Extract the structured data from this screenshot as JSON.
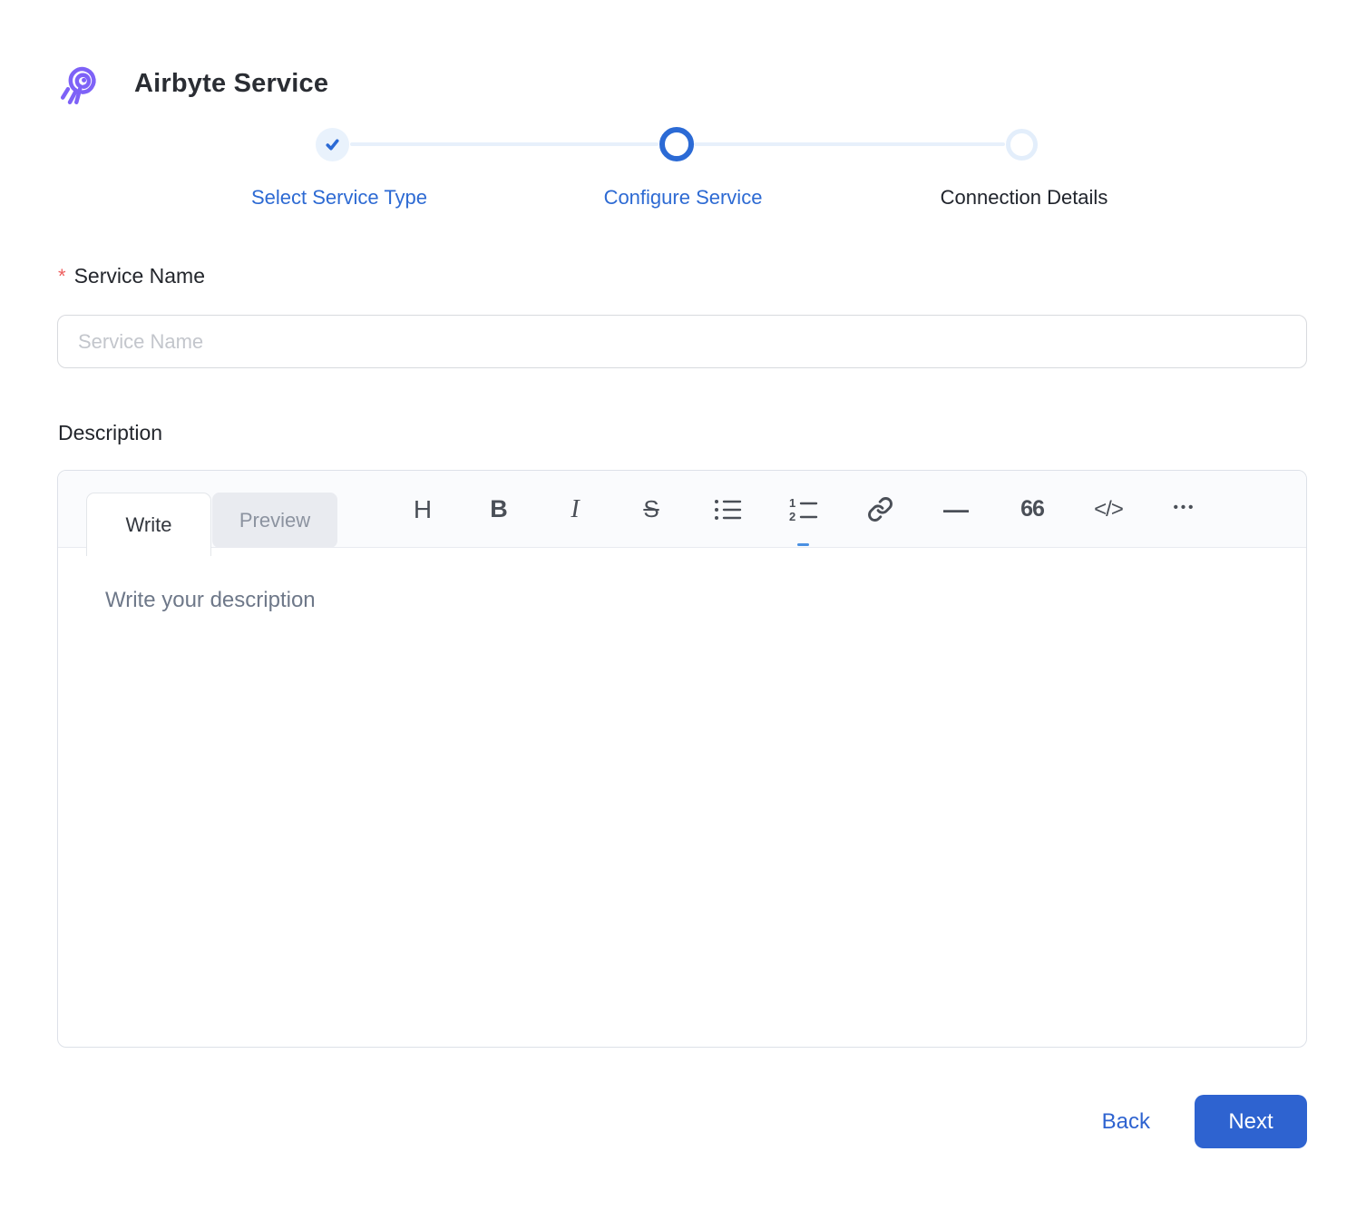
{
  "header": {
    "title": "Airbyte Service"
  },
  "stepper": {
    "steps": [
      {
        "label": "Select Service Type",
        "state": "completed",
        "icon": "check-icon"
      },
      {
        "label": "Configure Service",
        "state": "active",
        "icon": "ring-icon"
      },
      {
        "label": "Connection Details",
        "state": "upcoming",
        "icon": "ring-icon"
      }
    ]
  },
  "form": {
    "service_name": {
      "required_marker": "*",
      "label": "Service Name",
      "placeholder": "Service Name",
      "value": ""
    },
    "description": {
      "label": "Description",
      "tabs": [
        {
          "label": "Write"
        },
        {
          "label": "Preview"
        }
      ],
      "active_tab": "Write",
      "toolbar": {
        "heading": "H",
        "bold": "B",
        "italic": "I",
        "strikethrough": "S",
        "hr": "—",
        "quote": "66",
        "code": "</>",
        "more": "•••",
        "icons": [
          "heading-icon",
          "bold-icon",
          "italic-icon",
          "strikethrough-icon",
          "unordered-list-icon",
          "ordered-list-icon",
          "link-icon",
          "horizontal-rule-icon",
          "quote-icon",
          "code-icon",
          "more-icon"
        ]
      },
      "placeholder": "Write your description",
      "value": ""
    }
  },
  "actions": {
    "back_label": "Back",
    "next_label": "Next"
  },
  "colors": {
    "accent_blue": "#2e63d0",
    "stepper_light_blue": "#e7f0fb",
    "required_red": "#ee5f5f",
    "logo_purple": "#7e62f7"
  }
}
